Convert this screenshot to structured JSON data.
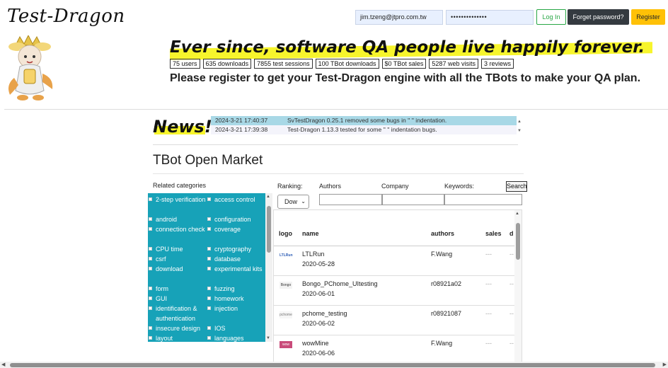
{
  "header": {
    "site_title": "Test-Dragon",
    "login": {
      "email_value": "jim.tzeng@jtpro.com.tw",
      "password_value": "••••••••••••••",
      "login_label": "Log In",
      "forgot_label": "Forget password?",
      "register_label": "Register"
    }
  },
  "hero": {
    "slogan": "Ever since, software QA people live happily forever.",
    "stats": [
      "75 users",
      "635 downloads",
      "7855 test sessions",
      "100 TBot downloads",
      "$0 TBot sales",
      "5287 web visits",
      "3 reviews"
    ],
    "tagline": "Please register to get your Test-Dragon engine with all the TBots to make your QA plan."
  },
  "news": {
    "label": "News!",
    "items": [
      {
        "date": "2024-3-21 17:40:37",
        "text": "SvTestDragon 0.25.1 removed some bugs in '' '' indentation."
      },
      {
        "date": "2024-3-21 17:39:38",
        "text": "Test-Dragon 1.13.3 tested for some '' '' indentation bugs."
      }
    ]
  },
  "market": {
    "title": "TBot Open Market",
    "related_label": "Related categories",
    "categories_left": [
      "2-step verification",
      "android",
      "connection check",
      "CPU time",
      "csrf",
      "download",
      "form",
      "GUI",
      "identification & authentication",
      "insecure design",
      "layout"
    ],
    "categories_right": [
      "access control",
      "configuration",
      "coverage",
      "cryptography",
      "database",
      "experimental kits",
      "fuzzing",
      "homework",
      "injection",
      "IOS",
      "languages"
    ],
    "filters": {
      "ranking_label": "Ranking:",
      "ranking_value": "Dow",
      "authors_label": "Authors",
      "company_label": "Company",
      "keywords_label": "Keywords:",
      "search_label": "Search"
    },
    "table": {
      "headers": {
        "logo": "logo",
        "name": "name",
        "authors": "authors",
        "sales": "sales",
        "downloads": "d"
      },
      "rows": [
        {
          "logo": "LTLRun",
          "name": "LTLRun",
          "date": "2020-05-28",
          "author": "F.Wang",
          "sales": "---",
          "downloads": "--"
        },
        {
          "logo": "Bongo",
          "name": "Bongo_PChome_UItesting",
          "date": "2020-06-01",
          "author": "r08921a02",
          "sales": "---",
          "downloads": "--"
        },
        {
          "logo": "pchome",
          "name": "pchome_testing",
          "date": "2020-06-02",
          "author": "r08921087",
          "sales": "---",
          "downloads": "--"
        },
        {
          "logo": "wow",
          "name": "wowMine",
          "date": "2020-06-06",
          "author": "F.Wang",
          "sales": "---",
          "downloads": "--"
        }
      ]
    }
  },
  "colors": {
    "accent_yellow": "#f7f52c",
    "category_bg": "#17a2b8",
    "login_green": "#28a745",
    "register_yellow": "#ffc107"
  }
}
